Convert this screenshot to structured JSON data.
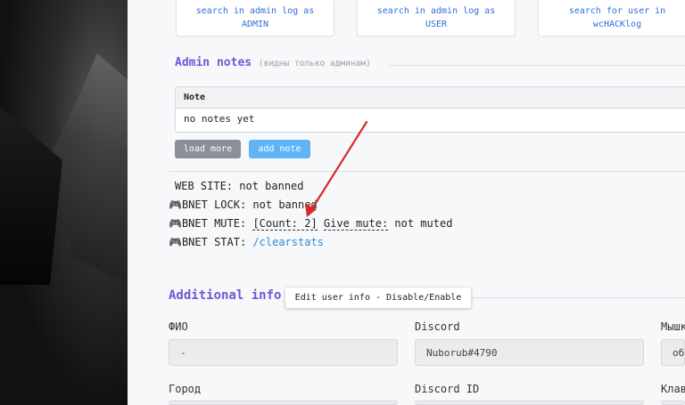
{
  "search_buttons": [
    {
      "line1": "search in admin log as",
      "line2": "ADMIN"
    },
    {
      "line1": "search in admin log as",
      "line2": "USER"
    },
    {
      "line1": "search for user in",
      "line2": "wcHACKlog"
    }
  ],
  "admin_notes": {
    "title": "Admin notes",
    "subtitle": "(видны только админам)",
    "column_header": "Note",
    "empty_text": "no notes yet",
    "load_more_label": "load more",
    "add_note_label": "add note"
  },
  "status": {
    "web_site": "WEB SITE: not banned",
    "bnet_lock": "BNET LOCK: not banned",
    "bnet_mute_prefix": "BNET MUTE: ",
    "bnet_mute_count": "[Count: 2]",
    "give_mute_label": "Give mute:",
    "mute_value": " not muted",
    "bnet_stat_prefix": "BNET STAT: ",
    "clearstats_link": "/clearstats",
    "gamepad_icon": "🎮"
  },
  "additional_info": {
    "title": "Additional info",
    "tooltip": "Edit user info - Disable/Enable",
    "fields": [
      {
        "label": "ФИО",
        "value": "-"
      },
      {
        "label": "Discord",
        "value": "Nuborub#4790"
      },
      {
        "label": "Мышк",
        "value": "об"
      },
      {
        "label": "Город",
        "value": ""
      },
      {
        "label": "Discord ID",
        "value": ""
      },
      {
        "label": "Клав",
        "value": ""
      }
    ]
  },
  "colors": {
    "accent_purple": "#6c58d6",
    "link_blue": "#2f8ad8",
    "button_blue": "#5fb4f7",
    "button_grey": "#8a9098",
    "arrow_red": "#d42a2a"
  }
}
